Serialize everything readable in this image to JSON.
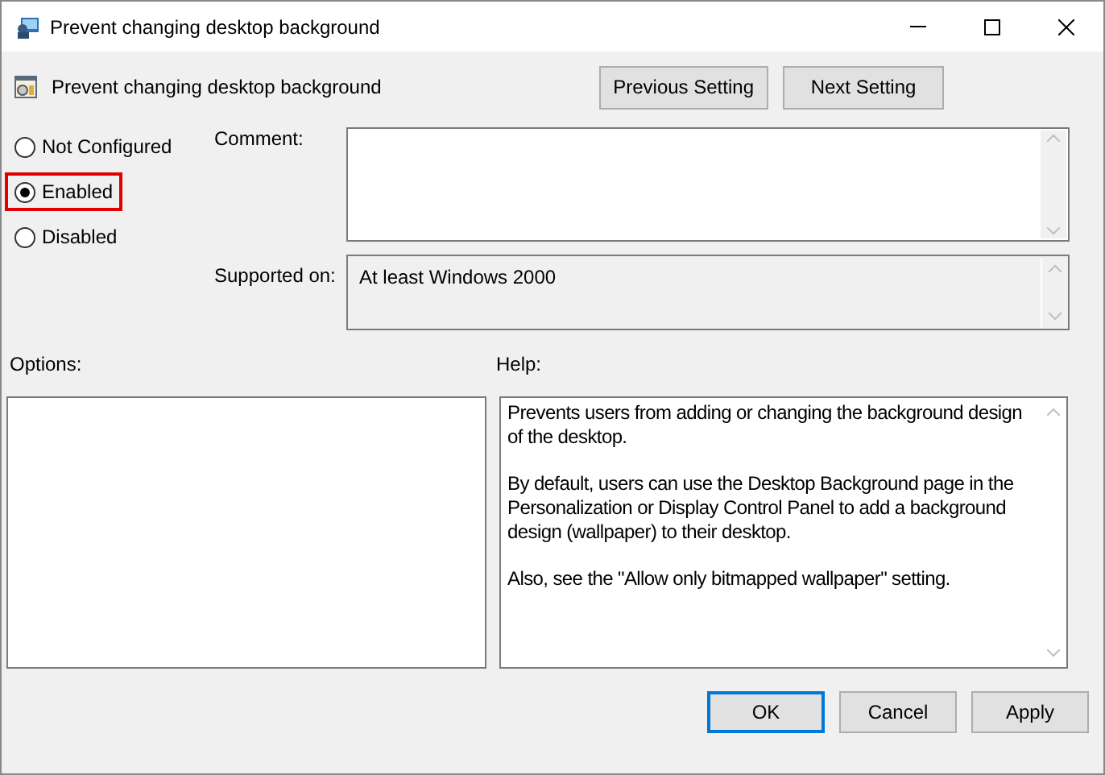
{
  "window": {
    "title": "Prevent changing desktop background"
  },
  "header": {
    "title": "Prevent changing desktop background",
    "buttons": [
      "Previous Setting",
      "Next Setting"
    ]
  },
  "state_options": [
    {
      "label": "Not Configured",
      "selected": false,
      "highlighted": false
    },
    {
      "label": "Enabled",
      "selected": true,
      "highlighted": true
    },
    {
      "label": "Disabled",
      "selected": false,
      "highlighted": false
    }
  ],
  "comment": {
    "label": "Comment:"
  },
  "supported_on": {
    "label": "Supported on:",
    "value": "At least Windows 2000"
  },
  "options": {
    "label": "Options:"
  },
  "help": {
    "label": "Help:",
    "paragraphs": [
      "Prevents users from adding or changing the background design of the desktop.",
      "By default, users can use the Desktop Background page in the Personalization or Display Control Panel to add a background design (wallpaper) to their desktop.",
      "Also, see the \"Allow only bitmapped wallpaper\" setting."
    ]
  },
  "buttons": [
    {
      "label": "OK",
      "default": true
    },
    {
      "label": "Cancel",
      "default": false
    },
    {
      "label": "Apply",
      "default": false
    }
  ]
}
